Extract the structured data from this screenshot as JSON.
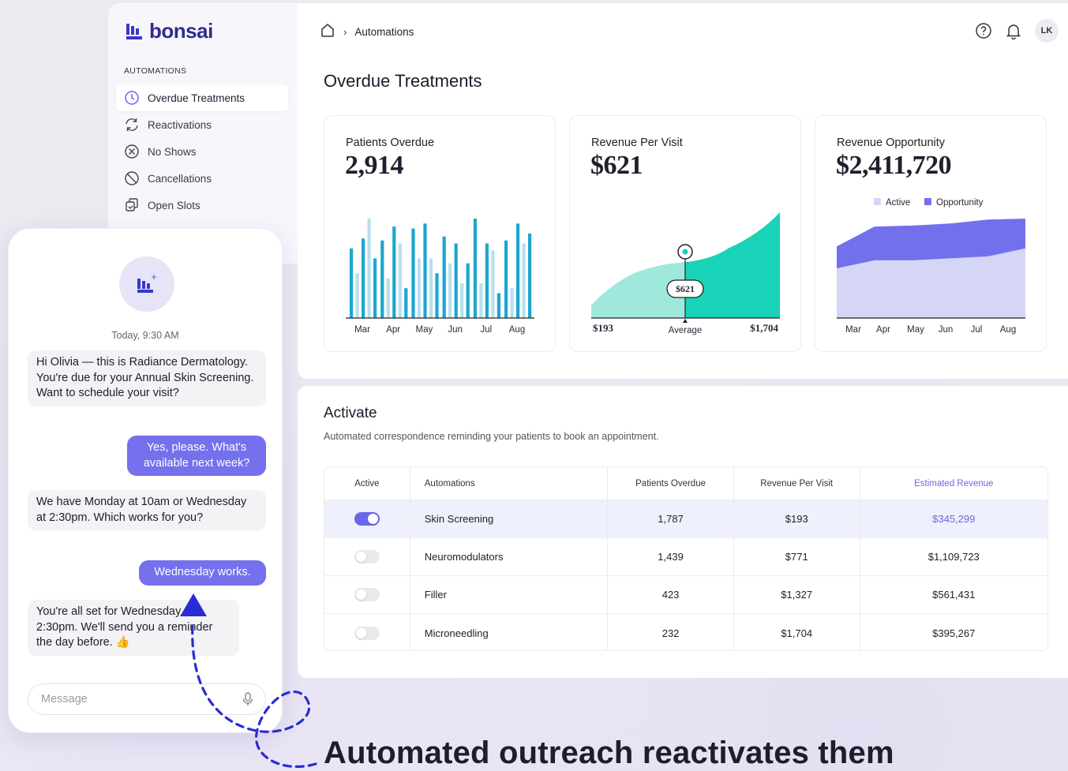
{
  "brand": {
    "name": "bonsai",
    "color": "#2f2e8c"
  },
  "sidebar": {
    "heading": "AUTOMATIONS",
    "items": [
      {
        "label": "Overdue Treatments",
        "icon": "clock-icon",
        "active": true
      },
      {
        "label": "Reactivations",
        "icon": "refresh-icon",
        "active": false
      },
      {
        "label": "No Shows",
        "icon": "x-circle-icon",
        "active": false
      },
      {
        "label": "Cancellations",
        "icon": "ban-icon",
        "active": false
      },
      {
        "label": "Open Slots",
        "icon": "copy-slot-icon",
        "active": false
      }
    ]
  },
  "header": {
    "breadcrumb": "Automations",
    "avatar_initials": "LK"
  },
  "page_title": "Overdue Treatments",
  "cards": {
    "patients": {
      "label": "Patients Overdue",
      "value": "2,914"
    },
    "revenue_visit": {
      "label": "Revenue Per Visit",
      "value": "$621",
      "min_label": "$193",
      "avg_label": "Average",
      "max_label": "$1,704",
      "marker_label": "$621"
    },
    "opportunity": {
      "label": "Revenue Opportunity",
      "value": "$2,411,720",
      "legend_active": "Active",
      "legend_opportunity": "Opportunity"
    }
  },
  "chart_data": [
    {
      "type": "bar",
      "categories": [
        "Mar",
        "Apr",
        "May",
        "Jun",
        "Jul",
        "Aug"
      ],
      "values": [
        [
          70,
          45,
          80,
          100,
          60
        ],
        [
          78,
          40,
          92,
          75,
          30
        ],
        [
          90,
          60,
          95,
          60,
          45
        ],
        [
          82,
          55,
          75,
          35,
          55
        ],
        [
          100,
          35,
          75,
          68,
          25
        ],
        [
          78,
          30,
          95,
          75,
          85
        ]
      ],
      "colors": {
        "dark": "#1ca6cf",
        "light": "#b9dfee"
      }
    },
    {
      "type": "area",
      "x": [
        "$193",
        "$621",
        "$1,704"
      ],
      "marker": "$621",
      "color": "#19d3b8"
    },
    {
      "type": "area",
      "categories": [
        "Mar",
        "Apr",
        "May",
        "Jun",
        "Jul",
        "Aug"
      ],
      "series": [
        {
          "name": "Active",
          "values": [
            0.5,
            0.58,
            0.58,
            0.6,
            0.62,
            0.7
          ]
        },
        {
          "name": "Opportunity",
          "values": [
            0.72,
            0.92,
            0.93,
            0.95,
            0.99,
            1.0
          ]
        }
      ],
      "colors": {
        "Active": "#d5d5f6",
        "Opportunity": "#7370ec"
      }
    }
  ],
  "activate": {
    "title": "Activate",
    "subtitle": "Automated correspondence reminding your patients to book an appointment.",
    "columns": [
      "Active",
      "Automations",
      "Patients Overdue",
      "Revenue Per Visit",
      "Estimated Revenue"
    ],
    "rows": [
      {
        "active": true,
        "name": "Skin Screening",
        "patients": "1,787",
        "rpv": "$193",
        "est": "$345,299"
      },
      {
        "active": false,
        "name": "Neuromodulators",
        "patients": "1,439",
        "rpv": "$771",
        "est": "$1,109,723"
      },
      {
        "active": false,
        "name": "Filler",
        "patients": "423",
        "rpv": "$1,327",
        "est": "$561,431"
      },
      {
        "active": false,
        "name": "Microneedling",
        "patients": "232",
        "rpv": "$1,704",
        "est": "$395,267"
      }
    ]
  },
  "phone": {
    "timestamp": "Today, 9:30 AM",
    "messages": [
      {
        "from": "clinic",
        "text": "Hi Olivia — this is Radiance Dermatology. You're due for your Annual Skin Screening. Want to schedule your visit?"
      },
      {
        "from": "patient",
        "text": "Yes, please. What's available next week?"
      },
      {
        "from": "clinic",
        "text": "We have Monday at 10am or Wednesday at 2:30pm. Which works for you?"
      },
      {
        "from": "patient",
        "text": "Wednesday works."
      },
      {
        "from": "clinic",
        "text": "You're all set for Wednesday at 2:30pm. We'll send you a reminder the day before. 👍"
      }
    ],
    "input_placeholder": "Message"
  },
  "tagline": "Automated outreach reactivates them"
}
